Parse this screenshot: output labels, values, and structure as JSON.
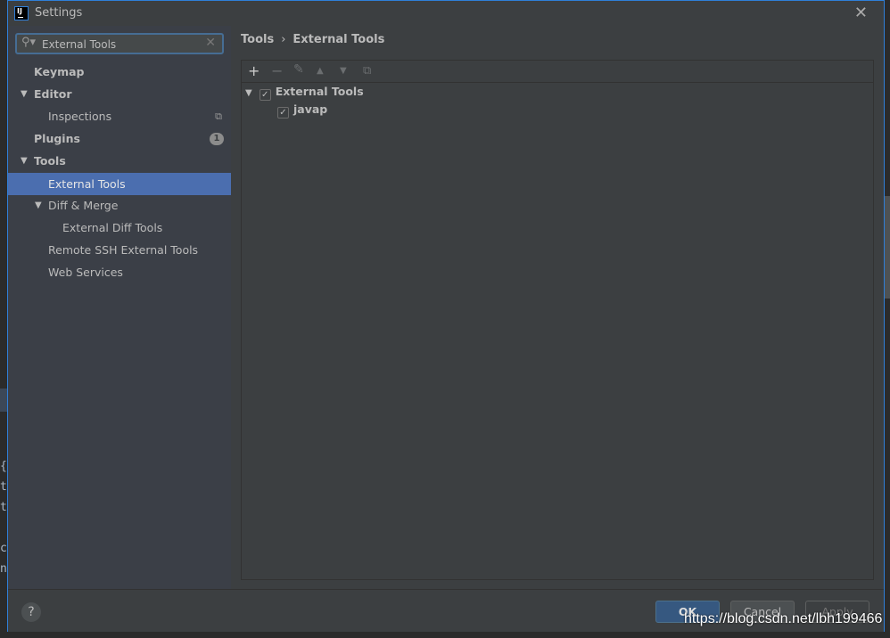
{
  "background": {
    "code_chars": [
      "{",
      "t",
      "t",
      "",
      "c",
      "n"
    ]
  },
  "window": {
    "title": "Settings",
    "logo": "IJ",
    "close_icon": "close-icon"
  },
  "search": {
    "value": "External Tools",
    "placeholder": ""
  },
  "sidebar": {
    "items": [
      {
        "label": "Keymap",
        "bold": true
      },
      {
        "label": "Editor",
        "bold": true,
        "expanded": true
      },
      {
        "label": "Inspections"
      },
      {
        "label": "Plugins",
        "bold": true,
        "badge": "1"
      },
      {
        "label": "Tools",
        "bold": true,
        "expanded": true
      },
      {
        "label": "External Tools",
        "selected": true
      },
      {
        "label": "Diff & Merge",
        "expanded": true
      },
      {
        "label": "External Diff Tools"
      },
      {
        "label": "Remote SSH External Tools"
      },
      {
        "label": "Web Services"
      }
    ]
  },
  "breadcrumb": {
    "parent": "Tools",
    "separator": "›",
    "current": "External Tools"
  },
  "toolbar": {
    "add": "+",
    "remove": "−",
    "edit": "✎",
    "up": "▲",
    "down": "▼",
    "copy": "⧉"
  },
  "tree": [
    {
      "label": "External Tools",
      "checked": true,
      "expanded": true
    },
    {
      "label": "javap",
      "checked": true
    }
  ],
  "footer": {
    "help": "?",
    "ok": "OK",
    "cancel": "Cancel",
    "apply": "Apply"
  },
  "watermark": "https://blog.csdn.net/lbh199466",
  "colors": {
    "selection": "#4b6eaf",
    "accent": "#2f7fd8",
    "ok_button": "#365880"
  }
}
